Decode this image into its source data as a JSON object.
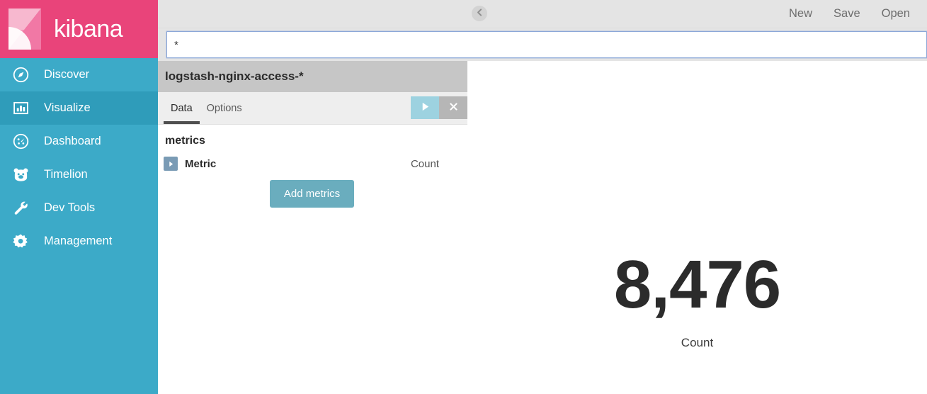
{
  "brand": {
    "name": "kibana",
    "logo_icon": "kibana-logo-icon",
    "brand_color": "#e9447a",
    "sidebar_color": "#3caac8"
  },
  "sidebar": {
    "items": [
      {
        "label": "Discover",
        "icon": "compass-icon",
        "active": false
      },
      {
        "label": "Visualize",
        "icon": "bar-chart-icon",
        "active": true
      },
      {
        "label": "Dashboard",
        "icon": "gauge-icon",
        "active": false
      },
      {
        "label": "Timelion",
        "icon": "bear-face-icon",
        "active": false
      },
      {
        "label": "Dev Tools",
        "icon": "wrench-icon",
        "active": false
      },
      {
        "label": "Management",
        "icon": "gear-icon",
        "active": false
      }
    ]
  },
  "topbar": {
    "new_label": "New",
    "save_label": "Save",
    "open_label": "Open"
  },
  "search": {
    "value": "*",
    "placeholder": "Search..."
  },
  "editor": {
    "index_pattern": "logstash-nginx-access-*",
    "tabs": [
      {
        "label": "Data",
        "active": true
      },
      {
        "label": "Options",
        "active": false
      }
    ],
    "apply_icon": "play-icon",
    "discard_icon": "close-icon",
    "collapse_icon": "chevron-left-circle-icon",
    "section_title": "metrics",
    "aggregation": {
      "expand_icon": "triangle-right-icon",
      "label": "Metric",
      "value": "Count"
    },
    "add_metrics_label": "Add metrics"
  },
  "visualization": {
    "type": "metric",
    "value": "8,476",
    "label": "Count"
  }
}
